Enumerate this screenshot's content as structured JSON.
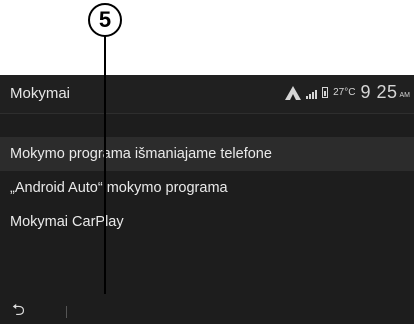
{
  "callout": {
    "number": "5"
  },
  "header": {
    "title": "Mokymai",
    "temperature": "27°C",
    "time": "9 25",
    "ampm": "AM"
  },
  "menu": {
    "items": [
      {
        "label": "Mokymo programa išmaniajame telefone"
      },
      {
        "label": "„Android Auto“ mokymo programa"
      },
      {
        "label": "Mokymai CarPlay"
      }
    ]
  },
  "icons": {
    "status": [
      "android-auto-icon",
      "signal-icon",
      "battery-icon"
    ],
    "footer": [
      "back-icon"
    ]
  }
}
